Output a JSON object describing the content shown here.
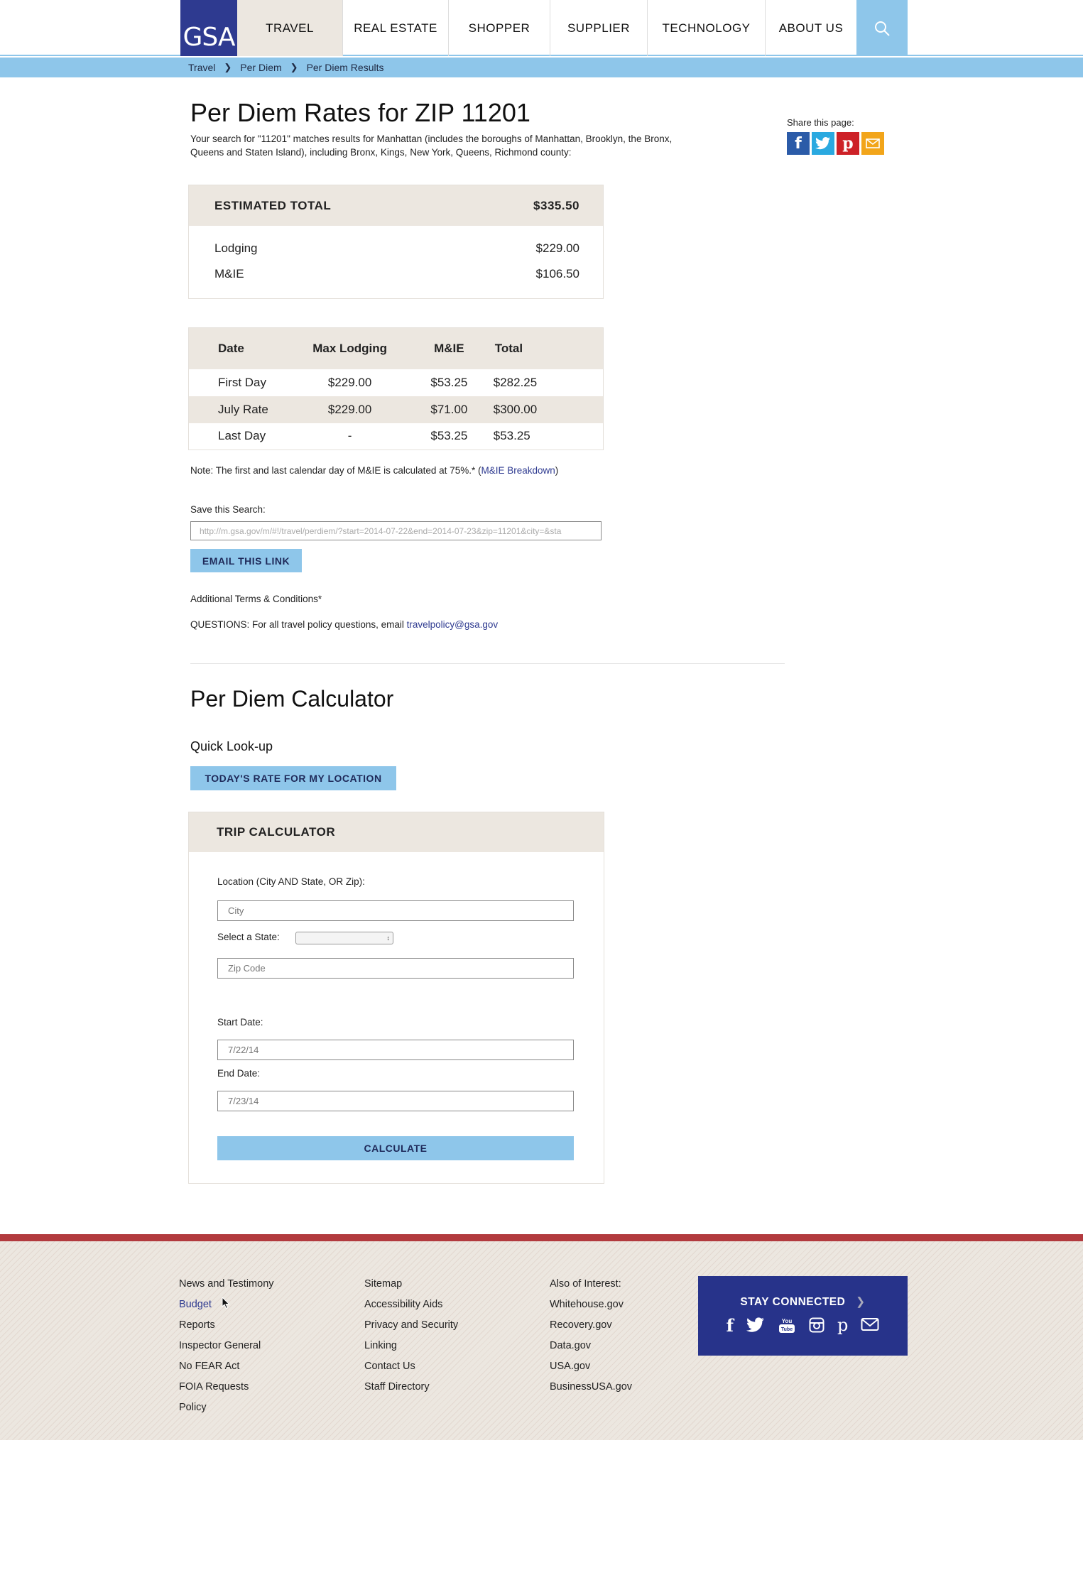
{
  "header": {
    "logo_text": "GSA",
    "nav": [
      {
        "label": "TRAVEL",
        "active": true
      },
      {
        "label": "REAL ESTATE",
        "active": false
      },
      {
        "label": "SHOPPER",
        "active": false
      },
      {
        "label": "SUPPLIER",
        "active": false
      },
      {
        "label": "TECHNOLOGY",
        "active": false
      },
      {
        "label": "ABOUT US",
        "active": false
      }
    ],
    "search_icon": "search-icon"
  },
  "breadcrumb": [
    "Travel",
    "Per Diem",
    "Per Diem Results"
  ],
  "page": {
    "title": "Per Diem Rates for ZIP 11201",
    "intro": "Your search for \"11201\" matches results for Manhattan (includes the boroughs of Manhattan, Brooklyn, the Bronx, Queens and Staten Island), including Bronx, Kings, New York, Queens, Richmond county:"
  },
  "share": {
    "label": "Share this page:",
    "icons": [
      "facebook-icon",
      "twitter-icon",
      "pinterest-icon",
      "email-icon"
    ],
    "colors": {
      "facebook": "#2b5ba8",
      "twitter": "#2aa9e0",
      "pinterest": "#cd2127",
      "email": "#f2a51a"
    }
  },
  "estimate": {
    "header_label": "ESTIMATED TOTAL",
    "header_value": "$335.50",
    "rows": [
      {
        "label": "Lodging",
        "value": "$229.00"
      },
      {
        "label": "M&IE",
        "value": "$106.50"
      }
    ]
  },
  "rates_table": {
    "columns": [
      "Date",
      "Max Lodging",
      "M&IE",
      "Total"
    ],
    "rows": [
      [
        "First Day",
        "$229.00",
        "$53.25",
        "$282.25"
      ],
      [
        "July Rate",
        "$229.00",
        "$71.00",
        "$300.00"
      ],
      [
        "Last Day",
        "-",
        "$53.25",
        "$53.25"
      ]
    ]
  },
  "note": {
    "text": "Note:  The first and last calendar day of M&IE is calculated at 75%.* (",
    "link": "M&IE Breakdown",
    "close": ")"
  },
  "save_search": {
    "label": "Save this Search:",
    "value": "http://m.gsa.gov/m/#!/travel/perdiem/?start=2014-07-22&end=2014-07-23&zip=11201&city=&sta",
    "email_button": "EMAIL THIS LINK"
  },
  "terms": "Additional Terms & Conditions*",
  "questions": {
    "text": "QUESTIONS: For all travel policy questions, email ",
    "email": "travelpolicy@gsa.gov"
  },
  "calculator": {
    "title": "Per Diem Calculator",
    "quick_lookup": "Quick Look-up",
    "todays_rate_button": "TODAY'S RATE FOR MY LOCATION",
    "trip": {
      "header": "TRIP CALCULATOR",
      "location_label": "Location (City AND State, OR Zip):",
      "city_placeholder": "City",
      "state_label": "Select a State:",
      "state_value": "",
      "zip_placeholder": "Zip Code",
      "start_label": "Start Date:",
      "start_placeholder": "7/22/14",
      "end_label": "End Date:",
      "end_placeholder": "7/23/14",
      "calculate_button": "CALCULATE"
    }
  },
  "footer": {
    "col1": [
      "News and Testimony",
      "Budget",
      "Reports",
      "Inspector General",
      "No FEAR Act",
      "FOIA Requests",
      "Policy"
    ],
    "col2": [
      "Sitemap",
      "Accessibility Aids",
      "Privacy and Security",
      "Linking",
      "Contact Us",
      "Staff Directory"
    ],
    "col3": [
      "Also of Interest:",
      "Whitehouse.gov",
      "Recovery.gov",
      "Data.gov",
      "USA.gov",
      "BusinessUSA.gov"
    ],
    "stay_connected": "STAY CONNECTED",
    "social_icons": [
      "facebook-icon",
      "twitter-icon",
      "youtube-icon",
      "instagram-icon",
      "pinterest-icon",
      "email-icon"
    ],
    "accent_color": "#b23a3e",
    "panel_color": "#27338a"
  }
}
